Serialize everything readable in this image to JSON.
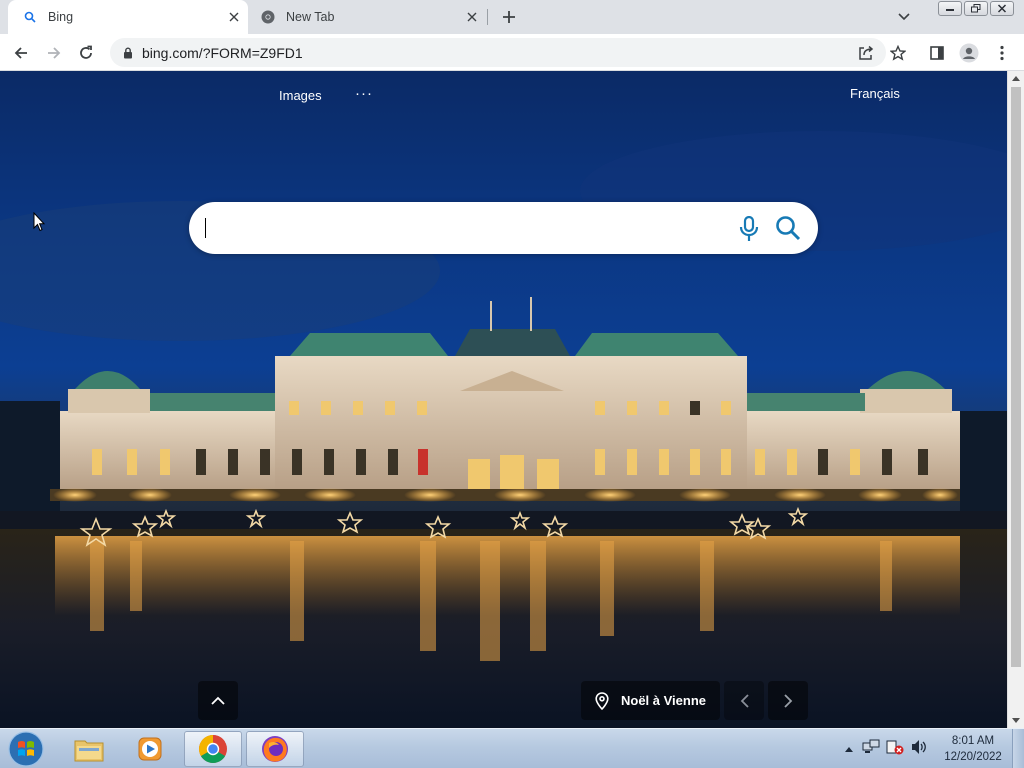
{
  "browser": {
    "tabs": [
      {
        "title": "Bing",
        "favicon": "search-icon",
        "active": true
      },
      {
        "title": "New Tab",
        "favicon": "chrome-icon",
        "active": false
      }
    ],
    "address_bar": {
      "url": "bing.com/?FORM=Z9FD1"
    }
  },
  "bing": {
    "nav": {
      "images_label": "Images",
      "more_label": "···"
    },
    "language_link": "Français",
    "search": {
      "value": "",
      "placeholder": ""
    },
    "image_caption": "Noël à Vienne"
  },
  "taskbar": {
    "items": [
      {
        "name": "windows-explorer",
        "state": "pinned"
      },
      {
        "name": "media-player",
        "state": "pinned"
      },
      {
        "name": "chrome",
        "state": "running"
      },
      {
        "name": "firefox",
        "state": "running"
      }
    ],
    "clock": {
      "time": "8:01 AM",
      "date": "12/20/2022"
    }
  },
  "colors": {
    "bing_accent": "#177ab5",
    "chrome_frame": "#dee1e6",
    "taskbar": "#b6c9e0"
  }
}
